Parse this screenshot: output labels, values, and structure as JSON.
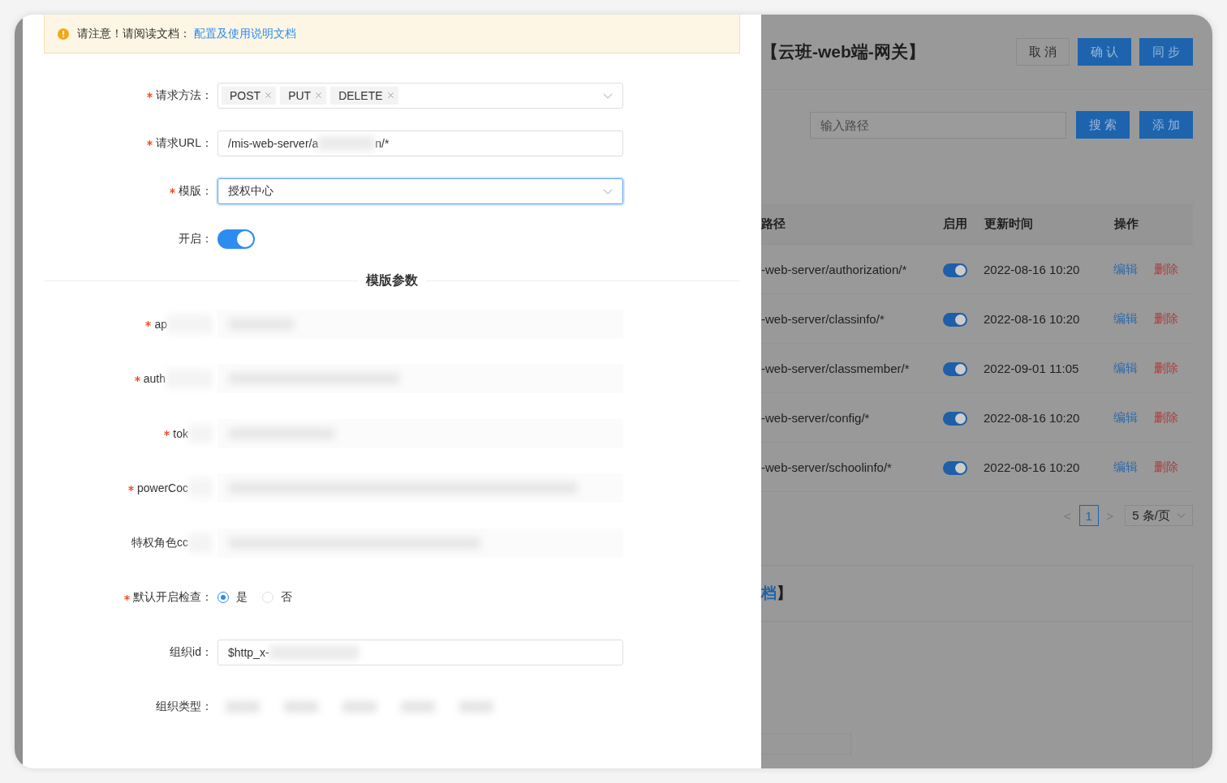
{
  "notice": {
    "text": "请注意！请阅读文档：",
    "link": "配置及使用说明文档"
  },
  "form": [
    {
      "kind": "tags",
      "label": "请求方法：",
      "required": true,
      "tags": [
        "POST",
        "PUT",
        "DELETE"
      ]
    },
    {
      "kind": "text",
      "label": "请求URL：",
      "required": true,
      "value": "/mis-web-server/a",
      "value_tail": "n/*"
    },
    {
      "kind": "select",
      "label": "模版：",
      "required": true,
      "value": "授权中心",
      "focused": true
    },
    {
      "kind": "switch",
      "label": "开启：",
      "required": false,
      "on": true
    }
  ],
  "section_title": "模版参数",
  "params": [
    {
      "kind": "blurred",
      "label": "ap",
      "required": true
    },
    {
      "kind": "blurred",
      "label": "auth",
      "required": true
    },
    {
      "kind": "blurred",
      "label": "tok",
      "required": true
    },
    {
      "kind": "blurred",
      "label": "powerCoc",
      "required": true
    },
    {
      "kind": "blurred",
      "label": "特权角色cc",
      "required": false
    },
    {
      "kind": "radio",
      "label": "默认开启检查：",
      "required": true,
      "options": [
        {
          "label": "是",
          "selected": true
        },
        {
          "label": "否",
          "selected": false
        }
      ]
    },
    {
      "kind": "text",
      "label": "组织id：",
      "required": false,
      "value": "$http_x-"
    },
    {
      "kind": "blurred-radio",
      "label": "组织类型：",
      "required": false
    }
  ],
  "page": {
    "title": "【云班-web端-网关】",
    "buttons": [
      {
        "label": "取 消",
        "kind": "default"
      },
      {
        "label": "确 认",
        "kind": "primary"
      },
      {
        "label": "同 步",
        "kind": "primary"
      }
    ],
    "search": {
      "placeholder": "输入路径"
    },
    "search_buttons": [
      "搜 索",
      "添 加"
    ],
    "columns": [
      "路径",
      "启用",
      "更新时间",
      "操作"
    ],
    "rows": [
      {
        "path": "-web-server/authorization/*",
        "enabled": true,
        "updated": "2022-08-16 10:20",
        "edit": "编辑",
        "delete": "删除"
      },
      {
        "path": "-web-server/classinfo/*",
        "enabled": true,
        "updated": "2022-08-16 10:20",
        "edit": "编辑",
        "delete": "删除"
      },
      {
        "path": "-web-server/classmember/*",
        "enabled": true,
        "updated": "2022-09-01 11:05",
        "edit": "编辑",
        "delete": "删除"
      },
      {
        "path": "-web-server/config/*",
        "enabled": true,
        "updated": "2022-08-16 10:20",
        "edit": "编辑",
        "delete": "删除"
      },
      {
        "path": "-web-server/schoolinfo/*",
        "enabled": true,
        "updated": "2022-08-16 10:20",
        "edit": "编辑",
        "delete": "删除"
      }
    ],
    "pagination": {
      "prev": "<",
      "next": ">",
      "pages": [
        {
          "label": "1",
          "selected": true
        }
      ],
      "page_size": "5 条/页"
    },
    "section_heading": {
      "link": "档",
      "text": "】"
    }
  }
}
